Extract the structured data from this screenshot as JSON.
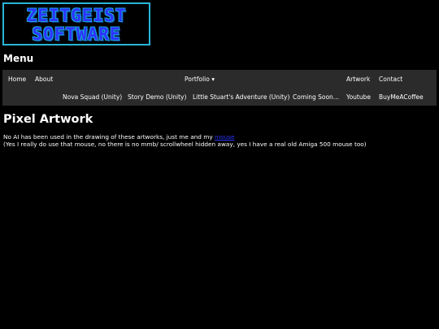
{
  "logo": {
    "line1": "ZEITGEIST",
    "line2": "SOFTWARE"
  },
  "menu_heading": "Menu",
  "nav": {
    "home": "Home",
    "about": "About",
    "portfolio": "Portfolio ▾",
    "artwork": "Artwork",
    "contact": "Contact",
    "youtube": "Youtube",
    "buymeacoffee": "BuyMeACoffee",
    "portfolio_items": [
      "Nova Squad (Unity)",
      "Story Demo (Unity)",
      "Little Stuart's Adventure (Unity)",
      "Coming Soon..."
    ]
  },
  "page": {
    "title": "Pixel Artwork",
    "line1_text": "No AI has been used in the drawing of these artworks, just me and my",
    "line1_link": "mouse",
    "line2": "(Yes I really do use that mouse, no there is no mmb/ scrollwheel hidden away, yes I have a real old Amiga 500 mouse too)"
  },
  "colors": {
    "background": "#000000",
    "nav_bg": "#2b2b2b",
    "link": "#2b34ff",
    "logo_border": "#29b6d6"
  }
}
